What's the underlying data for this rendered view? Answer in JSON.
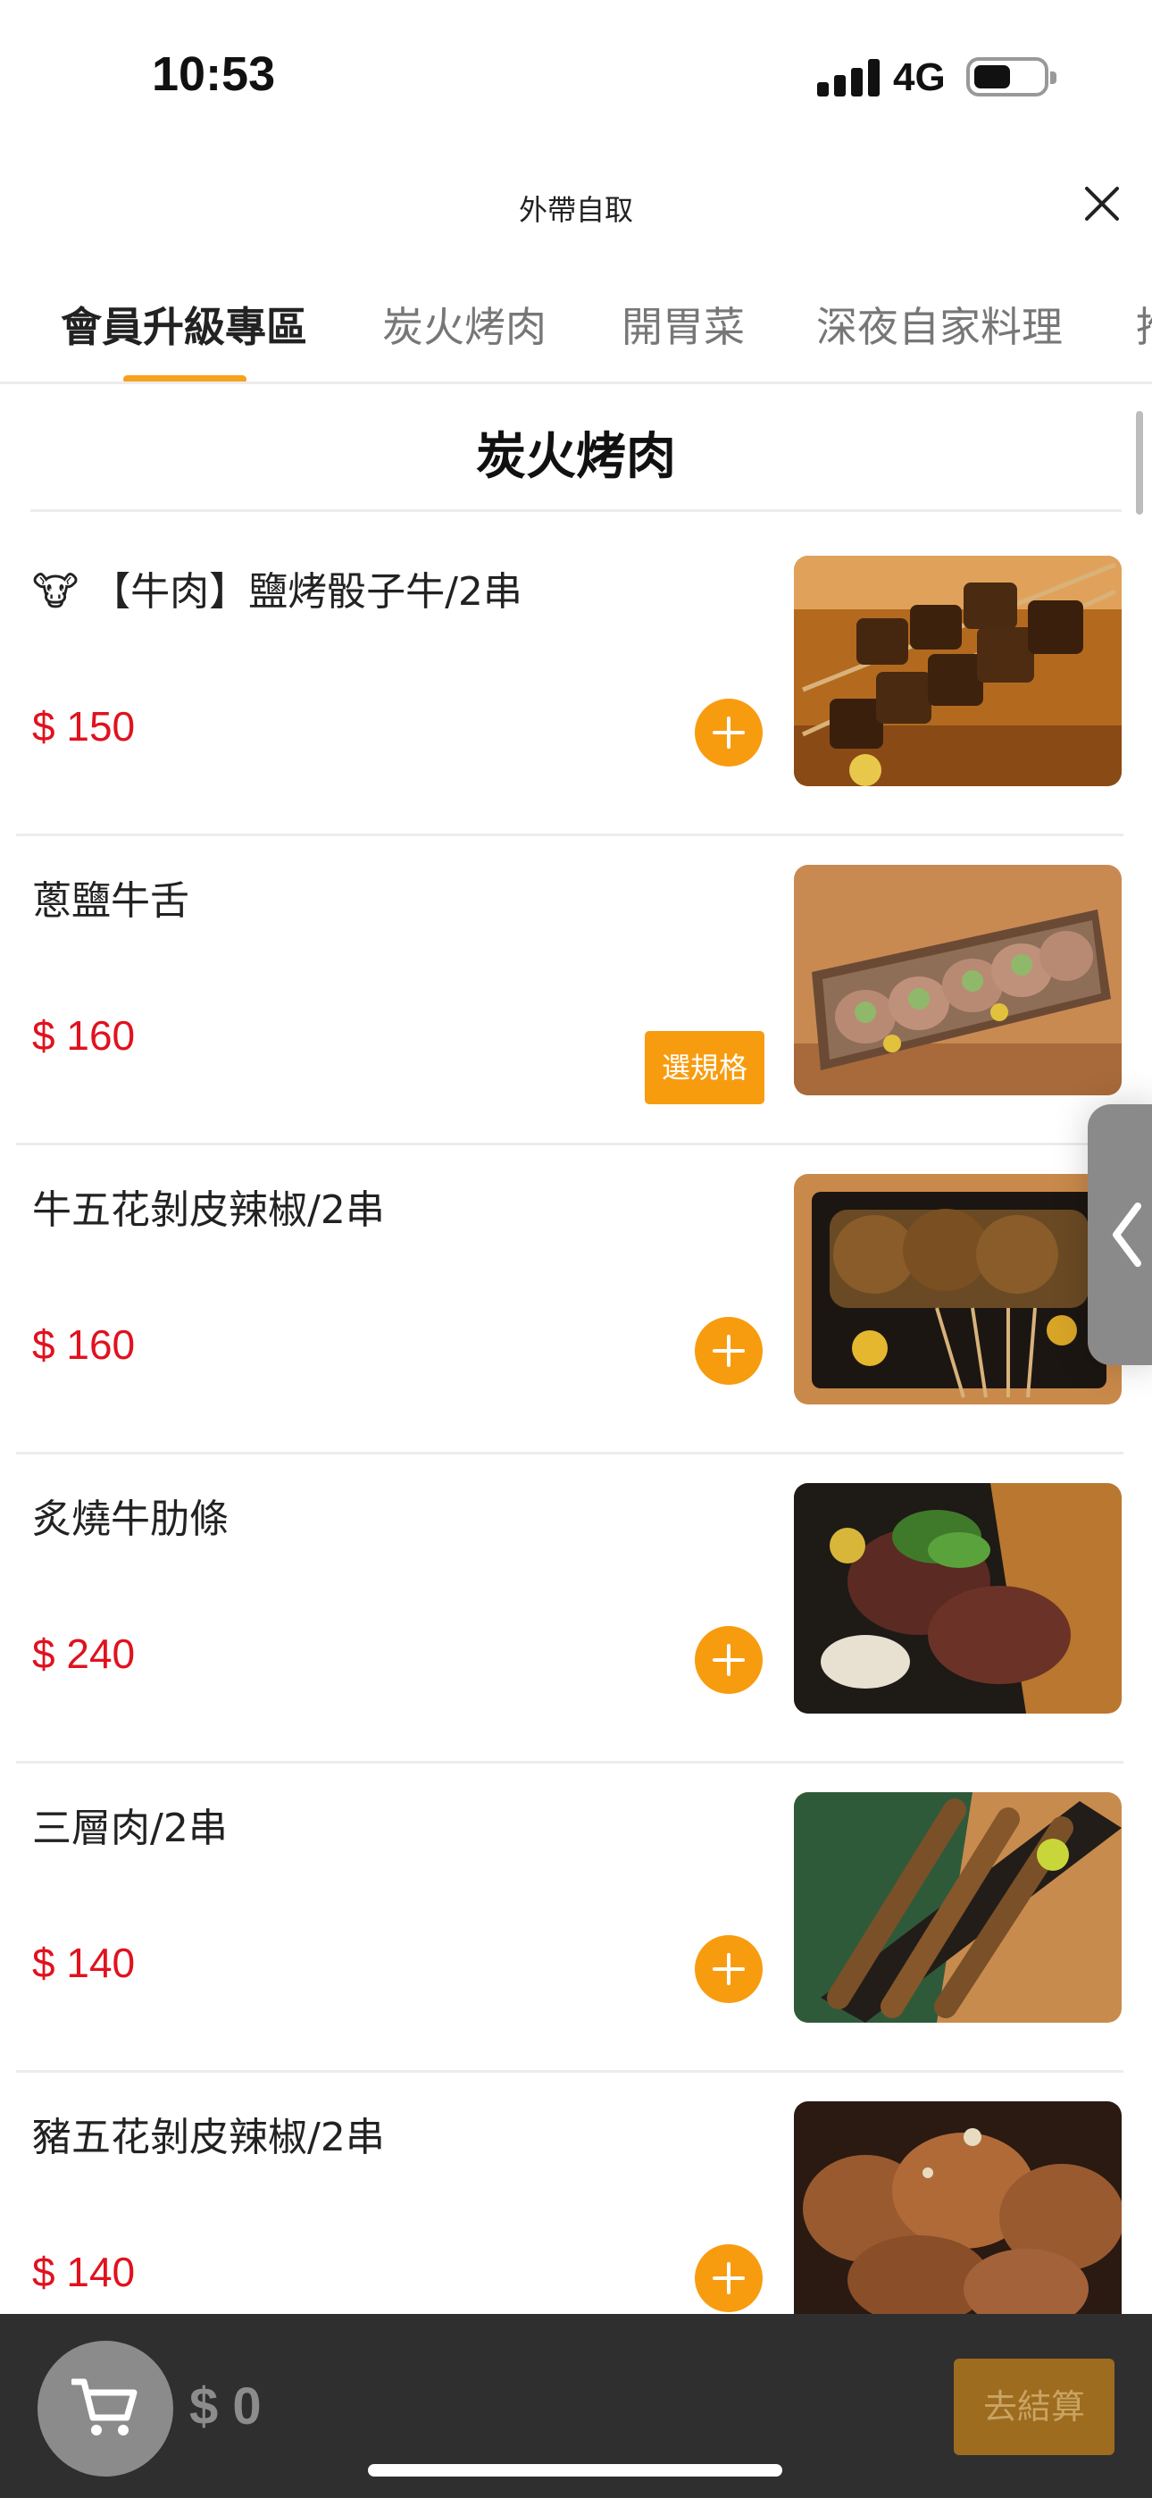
{
  "status_bar": {
    "time": "10:53",
    "network": "4G"
  },
  "header": {
    "title": "外帶自取"
  },
  "tabs": [
    {
      "label": "會員升級專區",
      "active": true
    },
    {
      "label": "炭火烤肉",
      "active": false
    },
    {
      "label": "開胃菜",
      "active": false
    },
    {
      "label": "深夜自家料理",
      "active": false
    },
    {
      "label": "推",
      "active": false
    }
  ],
  "section": {
    "title": "炭火烤肉"
  },
  "items": [
    {
      "name": "🐮 【牛肉】鹽烤骰子牛/2串",
      "price": "$ 150",
      "action": "add",
      "icon": "plus-icon"
    },
    {
      "name": "蔥鹽牛舌",
      "price": "$ 160",
      "action": "spec",
      "spec_label": "選規格"
    },
    {
      "name": "牛五花剝皮辣椒/2串",
      "price": "$ 160",
      "action": "add",
      "icon": "plus-icon"
    },
    {
      "name": "炙燒牛肋條",
      "price": "$ 240",
      "action": "add",
      "icon": "plus-icon"
    },
    {
      "name": "三層肉/2串",
      "price": "$ 140",
      "action": "add",
      "icon": "plus-icon"
    },
    {
      "name": "豬五花剝皮辣椒/2串",
      "price": "$ 140",
      "action": "add",
      "icon": "plus-icon"
    }
  ],
  "cart": {
    "total": "$ 0",
    "checkout_label": "去結算",
    "icon": "cart-icon"
  },
  "colors": {
    "accent": "#f89c0f",
    "price": "#e0121e",
    "cart_bar": "#2f2f2f",
    "checkout": "#9e6c1f"
  }
}
